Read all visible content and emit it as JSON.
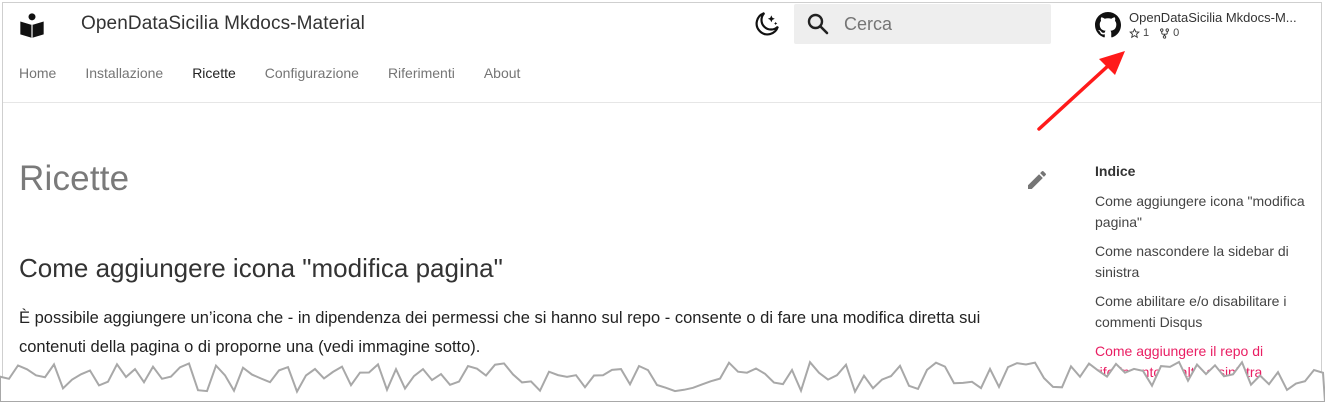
{
  "header": {
    "site_title": "OpenDataSicilia Mkdocs-Material",
    "search_placeholder": "Cerca",
    "repo": {
      "name": "OpenDataSicilia Mkdocs-M...",
      "stars": "1",
      "forks": "0"
    }
  },
  "tabs": [
    {
      "label": "Home"
    },
    {
      "label": "Installazione"
    },
    {
      "label": "Ricette"
    },
    {
      "label": "Configurazione"
    },
    {
      "label": "Riferimenti"
    },
    {
      "label": "About"
    }
  ],
  "main": {
    "page_title": "Ricette",
    "section_heading": "Come aggiungere icona \"modifica pagina\"",
    "paragraph": "È possibile aggiungere un’icona che - in dipendenza dei permessi che si hanno sul repo - consente o di fare una modifica diretta sui contenuti della pagina o di proporne una (vedi immagine sotto)."
  },
  "toc": {
    "title": "Indice",
    "items": [
      {
        "label": "Come aggiungere icona \"modifica pagina\""
      },
      {
        "label": "Come nascondere la sidebar di sinistra"
      },
      {
        "label": "Come abilitare e/o disabilitare i commenti Disqus"
      },
      {
        "label": "Come aggiungere il repo di riferimento in alto a sinistra"
      }
    ]
  },
  "icons": {
    "logo": "book-reader-icon",
    "theme_toggle": "moon-icon",
    "search": "search-icon",
    "github": "github-icon",
    "star": "star-icon",
    "fork": "fork-icon",
    "edit": "pencil-icon",
    "annotation": "red-arrow"
  },
  "colors": {
    "accent": "#e91e63",
    "search_bg": "#eeeeee",
    "arrow": "#ff0000"
  }
}
